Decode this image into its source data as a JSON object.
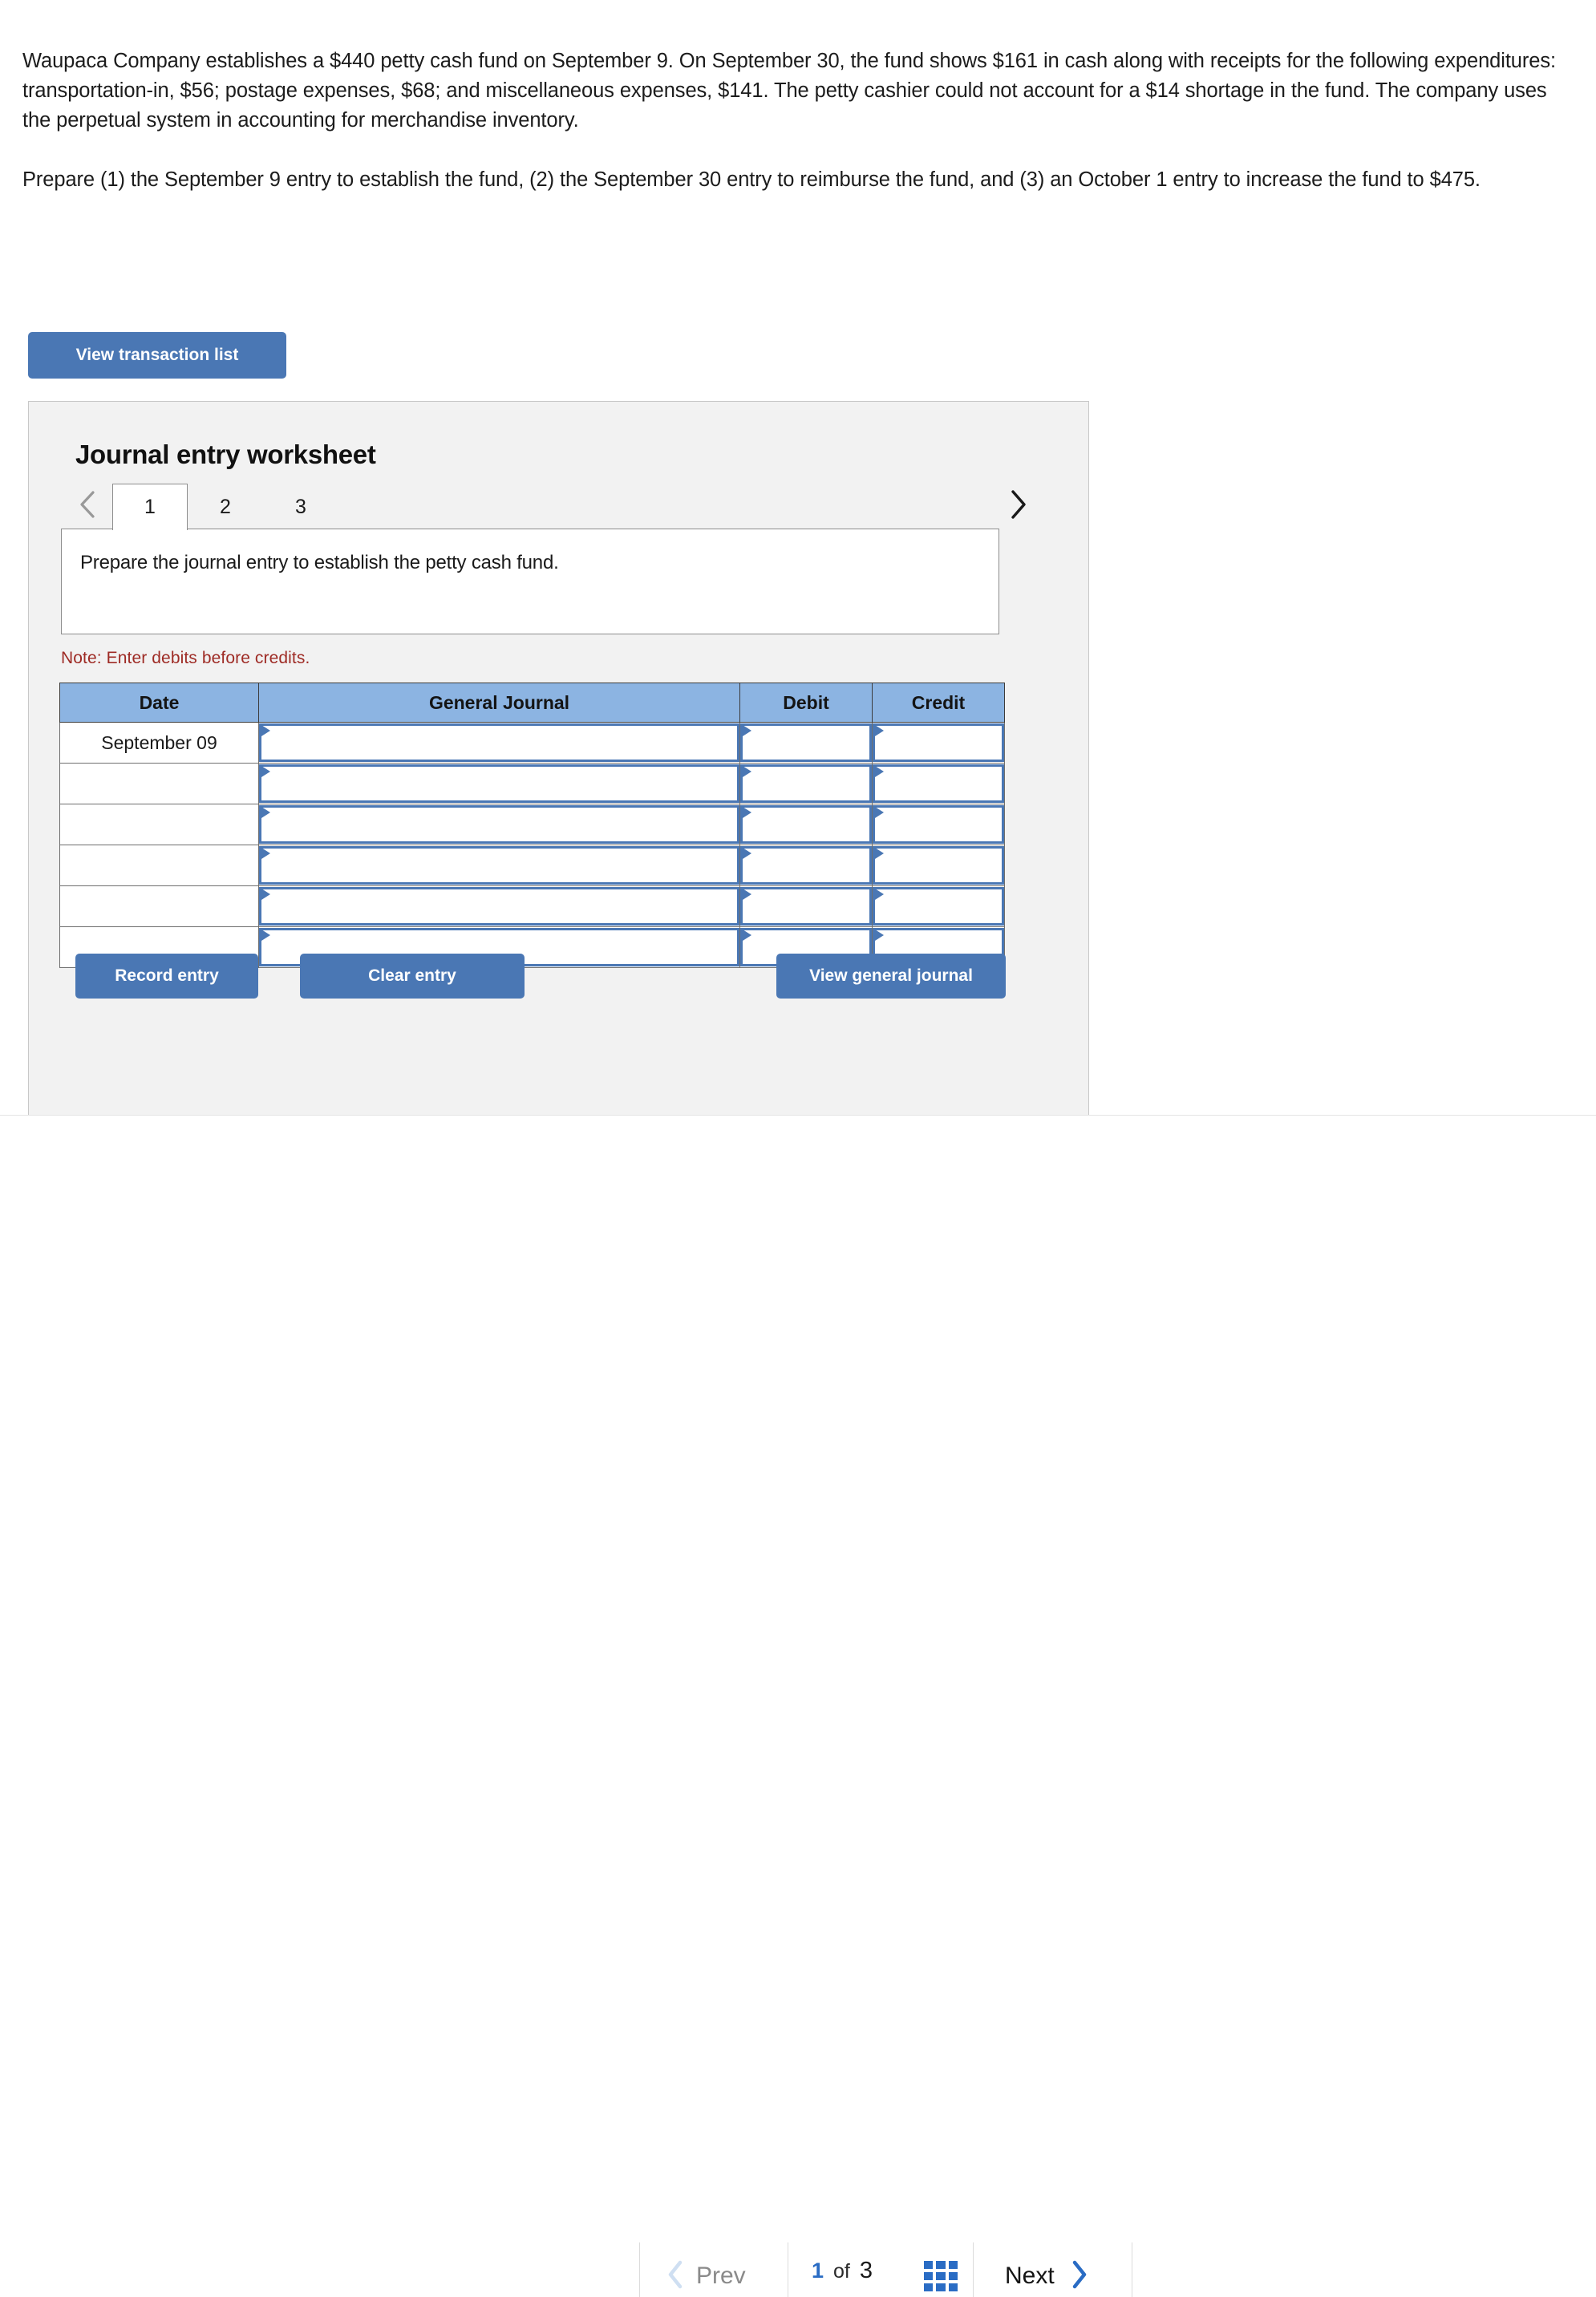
{
  "problem": {
    "paragraph_1": "Waupaca Company establishes a $440 petty cash fund on September 9. On September 30, the fund shows $161 in cash along with receipts for the following expenditures: transportation-in, $56; postage expenses, $68; and miscellaneous expenses, $141. The petty cashier could not account for a $14 shortage in the fund. The company uses the perpetual system in accounting for merchandise inventory.",
    "paragraph_2": "Prepare (1) the September 9 entry to establish the fund, (2) the September 30 entry to reimburse the fund, and (3) an October 1 entry to increase the fund to $475."
  },
  "view_transaction_list_label": "View transaction list",
  "worksheet": {
    "title": "Journal entry worksheet",
    "tabs": [
      {
        "label": "1",
        "active": true
      },
      {
        "label": "2",
        "active": false
      },
      {
        "label": "3",
        "active": false
      }
    ],
    "prev_tab_icon": "chevron-left-icon",
    "next_tab_icon": "chevron-right-icon",
    "instruction": "Prepare the journal entry to establish the petty cash fund.",
    "note": "Note: Enter debits before credits.",
    "table": {
      "headers": [
        "Date",
        "General Journal",
        "Debit",
        "Credit"
      ],
      "rows": [
        {
          "date": "September 09",
          "general_journal": "",
          "debit": "",
          "credit": ""
        },
        {
          "date": "",
          "general_journal": "",
          "debit": "",
          "credit": ""
        },
        {
          "date": "",
          "general_journal": "",
          "debit": "",
          "credit": ""
        },
        {
          "date": "",
          "general_journal": "",
          "debit": "",
          "credit": ""
        },
        {
          "date": "",
          "general_journal": "",
          "debit": "",
          "credit": ""
        },
        {
          "date": "",
          "general_journal": "",
          "debit": "",
          "credit": ""
        }
      ]
    },
    "buttons": {
      "record_entry": "Record entry",
      "clear_entry": "Clear entry",
      "view_general_journal": "View general journal"
    }
  },
  "bottom_nav": {
    "prev_label": "Prev",
    "prev_icon": "chevron-left-icon",
    "current_page": "1",
    "of_label": "of",
    "total_pages": "3",
    "grid_icon": "grid-view-icon",
    "next_label": "Next",
    "next_icon": "chevron-right-icon"
  },
  "colors": {
    "button_blue": "#4a77b4",
    "header_blue": "#8cb4e2",
    "note_red": "#9e2b25",
    "accent_blue": "#2a6cc4",
    "panel_gray": "#f2f2f2"
  }
}
